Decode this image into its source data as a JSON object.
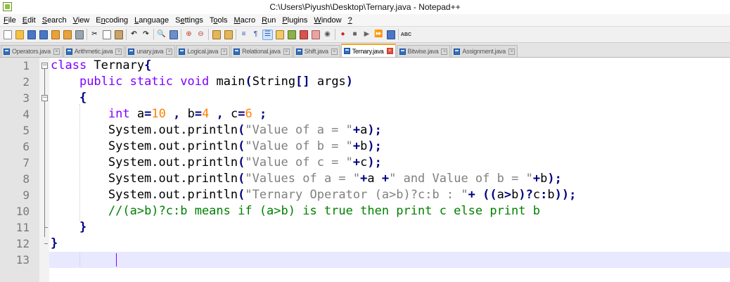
{
  "window": {
    "title": "C:\\Users\\Piyush\\Desktop\\Ternary.java - Notepad++"
  },
  "menu": [
    {
      "u": "F",
      "rest": "ile"
    },
    {
      "u": "E",
      "rest": "dit"
    },
    {
      "u": "S",
      "rest": "earch"
    },
    {
      "u": "V",
      "rest": "iew"
    },
    {
      "pre": "E",
      "u": "n",
      "rest": "coding"
    },
    {
      "u": "L",
      "rest": "anguage"
    },
    {
      "pre": "S",
      "u": "e",
      "rest": "ttings"
    },
    {
      "pre": "T",
      "u": "o",
      "rest": "ols"
    },
    {
      "u": "M",
      "rest": "acro"
    },
    {
      "u": "R",
      "rest": "un"
    },
    {
      "u": "P",
      "rest": "lugins"
    },
    {
      "u": "W",
      "rest": "indow"
    },
    {
      "u": "?",
      "rest": ""
    }
  ],
  "tabs": [
    {
      "label": "Operators.java",
      "active": false
    },
    {
      "label": "Arithmetic.java",
      "active": false
    },
    {
      "label": "unary.java",
      "active": false
    },
    {
      "label": "Logical.java",
      "active": false
    },
    {
      "label": "Relational.java",
      "active": false
    },
    {
      "label": "Shift.java",
      "active": false
    },
    {
      "label": "Ternary.java",
      "active": true
    },
    {
      "label": "Bitwise.java",
      "active": false
    },
    {
      "label": "Assignment.java",
      "active": false
    }
  ],
  "tab_close_glyph": "×",
  "colors": {
    "keyword": "#8000ff",
    "number": "#ff8000",
    "string": "#808080",
    "operator": "#000080",
    "comment": "#008000",
    "current_line": "#e8e8ff"
  },
  "editor": {
    "current_line": 13,
    "lines": [
      {
        "n": "1",
        "code": "class Ternary{"
      },
      {
        "n": "2",
        "code": "    public static void main(String[] args)"
      },
      {
        "n": "3",
        "code": "    {"
      },
      {
        "n": "4",
        "code": "        int a=10 , b=4 , c=6 ;"
      },
      {
        "n": "5",
        "code": "        System.out.println(\"Value of a = \"+a);"
      },
      {
        "n": "6",
        "code": "        System.out.println(\"Value of b = \"+b);"
      },
      {
        "n": "7",
        "code": "        System.out.println(\"Value of c = \"+c);"
      },
      {
        "n": "8",
        "code": "        System.out.println(\"Values of a = \"+a +\" and Value of b = \"+b);"
      },
      {
        "n": "9",
        "code": "        System.out.println(\"Ternary Operator (a>b)?c:b : \"+ ((a>b)?c:b));"
      },
      {
        "n": "10",
        "code": "        //(a>b)?c:b means if (a>b) is true then print c else print b"
      },
      {
        "n": "11",
        "code": "    }"
      },
      {
        "n": "12",
        "code": "}"
      },
      {
        "n": "13",
        "code": ""
      }
    ]
  }
}
